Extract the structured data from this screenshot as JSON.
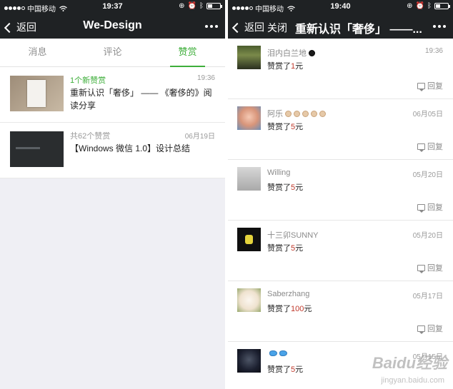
{
  "left_phone": {
    "status": {
      "carrier": "中国移动",
      "time": "19:37"
    },
    "nav": {
      "back_label": "返回",
      "title": "We-Design"
    },
    "tabs": [
      {
        "label": "消息",
        "active": false
      },
      {
        "label": "评论",
        "active": false
      },
      {
        "label": "赞赏",
        "active": true
      }
    ],
    "items": [
      {
        "head": "1个新赞赏",
        "time": "19:36",
        "desc": "重新认识「奢侈」 —— 《奢侈的》阅读分享"
      },
      {
        "head": "共62个赞赏",
        "time": "06月19日",
        "desc": "【Windows 微信 1.0】设计总结"
      }
    ]
  },
  "right_phone": {
    "status": {
      "carrier": "中国移动",
      "time": "19:40"
    },
    "nav": {
      "back_label": "返回",
      "close_label": "关闭",
      "title": "重新认识「奢侈」 ——..."
    },
    "reply_label": "回复",
    "amount_prefix": "赞赏了",
    "amount_suffix": "元",
    "records": [
      {
        "name": "泪内白兰地",
        "time": "19:36",
        "amount": "1"
      },
      {
        "name": "阿乐",
        "time": "06月05日",
        "amount": "5"
      },
      {
        "name": "Willing",
        "time": "05月20日",
        "amount": "5"
      },
      {
        "name": "十三卯SUNNY",
        "time": "05月20日",
        "amount": "5"
      },
      {
        "name": "Saberzhang",
        "time": "05月17日",
        "amount": "100"
      },
      {
        "name": "",
        "time": "05月15日",
        "amount": "5"
      }
    ]
  },
  "watermark": {
    "text": "Baidu经验",
    "url": "jingyan.baidu.com"
  },
  "colors": {
    "accent": "#3eae3a",
    "navbar": "#1f2224",
    "amount": "#c0392b"
  }
}
